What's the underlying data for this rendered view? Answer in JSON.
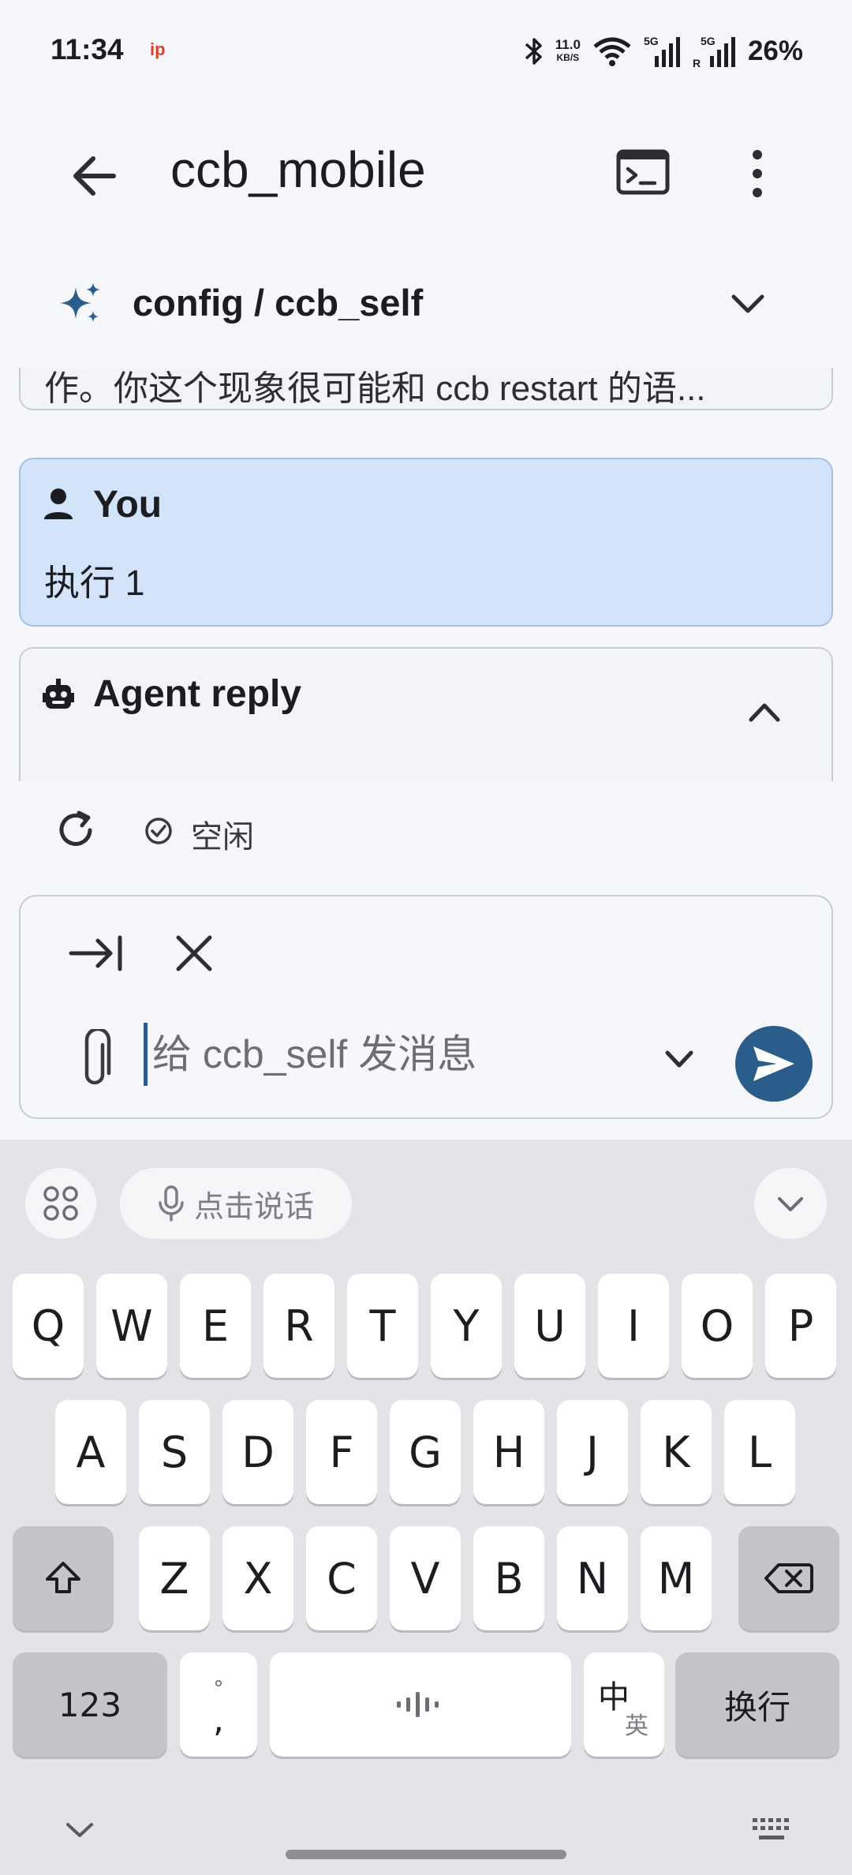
{
  "status_bar": {
    "time": "11:34",
    "app_badge": "ip",
    "net_speed_value": "11.0",
    "net_speed_unit": "KB/S",
    "battery": "26%",
    "icons": [
      "bluetooth-icon",
      "wifi-icon",
      "signal-5g-icon",
      "signal-5g-roaming-icon"
    ]
  },
  "app_bar": {
    "title": "ccb_mobile",
    "icons": [
      "back-arrow-icon",
      "terminal-icon",
      "more-vert-icon"
    ]
  },
  "session": {
    "title": "config / ccb_self",
    "icon": "sparkle-icon"
  },
  "chat": {
    "previous_message_excerpt": "作。你这个现象很可能和 ccb restart 的语...",
    "user_message": {
      "label": "You",
      "text": "执行 1"
    },
    "agent_message": {
      "label": "Agent reply"
    }
  },
  "status": {
    "state": "空闲"
  },
  "composer": {
    "placeholder": "给 ccb_self 发消息",
    "value": ""
  },
  "keyboard": {
    "voice_label": "点击说话",
    "row1": [
      "Q",
      "W",
      "E",
      "R",
      "T",
      "Y",
      "U",
      "I",
      "O",
      "P"
    ],
    "row2": [
      "A",
      "S",
      "D",
      "F",
      "G",
      "H",
      "J",
      "K",
      "L"
    ],
    "row3": [
      "Z",
      "X",
      "C",
      "V",
      "B",
      "N",
      "M"
    ],
    "numbers_key": "123",
    "punct_top": "°",
    "punct_bottom": ",",
    "lang_main": "中",
    "lang_alt": "英",
    "enter_key": "换行"
  },
  "colors": {
    "accent": "#2a5d89",
    "user_bubble": "#d3e3fa",
    "sparkle": "#2a5d89"
  }
}
